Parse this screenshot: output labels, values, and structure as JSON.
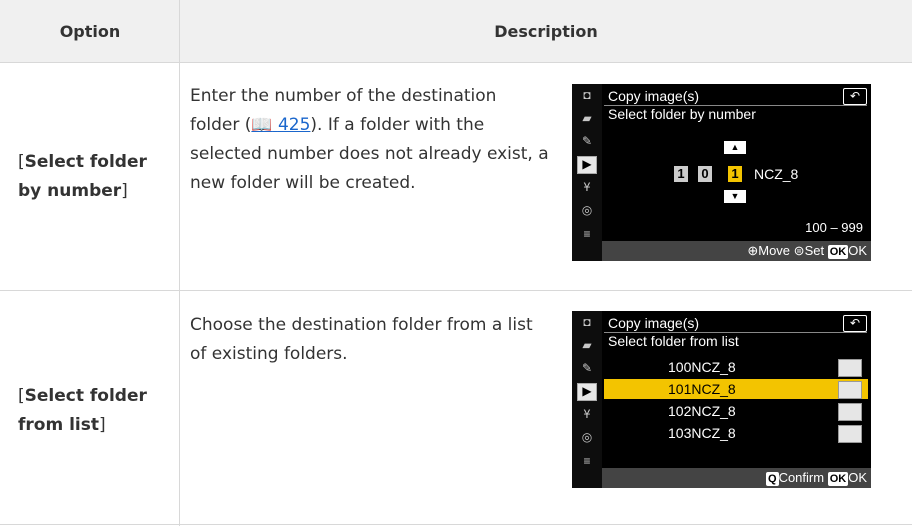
{
  "table": {
    "headers": {
      "option": "Option",
      "description": "Description"
    },
    "rows": [
      {
        "option_bracket_open": "[",
        "option_bold": "Select folder by number",
        "option_bracket_close": "]",
        "description_before": "Enter the number of the destination folder (",
        "ref_icon": "📖",
        "ref_page": "425",
        "description_after": "). If a folder with the selected number does not already exist, a new folder will be created."
      },
      {
        "option_bracket_open": "[",
        "option_bold": "Select folder from list",
        "option_bracket_close": "]",
        "description_before": "Choose the destination folder from a list of existing folders.",
        "ref_icon": "",
        "ref_page": "",
        "description_after": ""
      }
    ]
  },
  "screen1": {
    "title": "Copy image(s)",
    "subtitle": "Select folder by number",
    "back_icon": "↶",
    "digits": [
      "1",
      "0",
      "1"
    ],
    "folder_suffix": "NCZ_8",
    "range": "100 – 999",
    "footer_move": "Move",
    "footer_set": "Set",
    "footer_ok_key": "OK",
    "footer_ok": "OK",
    "up_arrow": "▲",
    "down_arrow": "▼"
  },
  "screen2": {
    "title": "Copy image(s)",
    "subtitle": "Select folder from list",
    "back_icon": "↶",
    "folders": [
      "100NCZ_8",
      "101NCZ_8",
      "102NCZ_8",
      "103NCZ_8"
    ],
    "selected_index": 1,
    "footer_confirm": "Confirm",
    "footer_ok_key": "OK",
    "footer_ok": "OK"
  },
  "side_icons": [
    "camera-icon",
    "movie-icon",
    "pencil-icon",
    "playback-icon",
    "wrench-icon",
    "network-icon",
    "mymenu-icon"
  ]
}
